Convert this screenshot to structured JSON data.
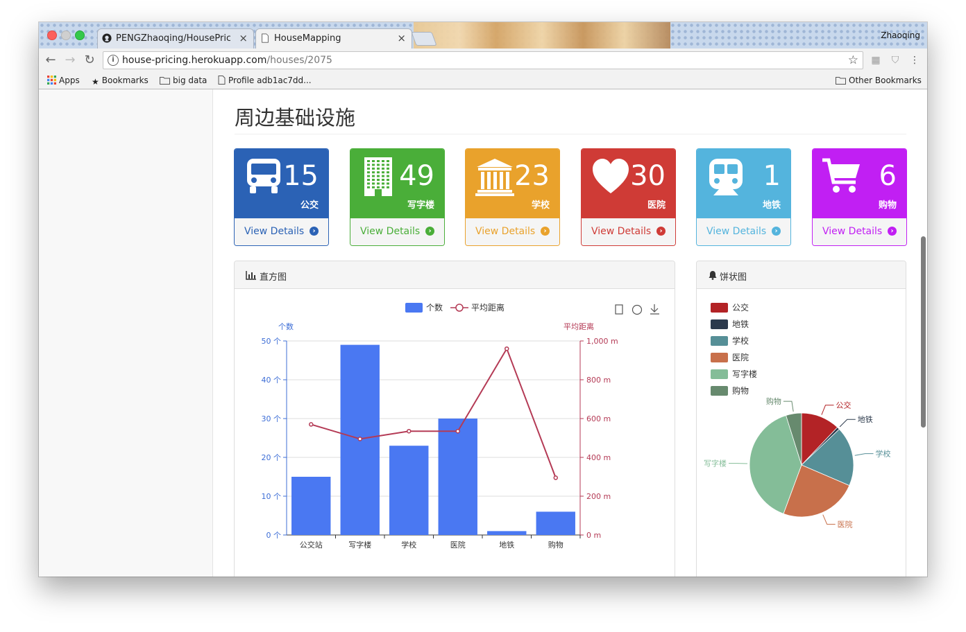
{
  "browser": {
    "tabs": [
      {
        "title": "PENGZhaoqing/HousePricing",
        "icon": "github-icon"
      },
      {
        "title": "HouseMapping",
        "icon": "page-icon"
      }
    ],
    "profile_name": "Zhaoqing",
    "url_host": "house-pricing.herokuapp.com",
    "url_path": "/houses/2075",
    "bookmarks": [
      {
        "label": "Apps",
        "icon": "apps-grid-icon"
      },
      {
        "label": "Bookmarks",
        "icon": "star-icon"
      },
      {
        "label": "big data",
        "icon": "folder-icon"
      },
      {
        "label": "Profile adb1ac7dd...",
        "icon": "page-icon"
      }
    ],
    "other_bookmarks": "Other Bookmarks"
  },
  "page": {
    "title": "周边基础设施",
    "cards": [
      {
        "count": "15",
        "label": "公交",
        "link": "View Details",
        "color": "#2b62b5",
        "icon": "bus-icon"
      },
      {
        "count": "49",
        "label": "写字楼",
        "link": "View Details",
        "color": "#4aae39",
        "icon": "office-building-icon"
      },
      {
        "count": "23",
        "label": "学校",
        "link": "View Details",
        "color": "#e9a22c",
        "icon": "school-icon"
      },
      {
        "count": "30",
        "label": "医院",
        "link": "View Details",
        "color": "#cf3b36",
        "icon": "heart-icon"
      },
      {
        "count": "1",
        "label": "地铁",
        "link": "View Details",
        "color": "#54b4dd",
        "icon": "subway-icon"
      },
      {
        "count": "6",
        "label": "购物",
        "link": "View Details",
        "color": "#c11ff3",
        "icon": "cart-icon"
      }
    ],
    "bar_panel_title": "直方图",
    "pie_panel_title": "饼状图"
  },
  "chart_data": [
    {
      "type": "bar",
      "legend": [
        "个数",
        "平均距离"
      ],
      "categories": [
        "公交站",
        "写字楼",
        "学校",
        "医院",
        "地铁",
        "购物"
      ],
      "series": [
        {
          "name": "个数",
          "type": "bar",
          "values": [
            15,
            49,
            23,
            30,
            1,
            6
          ],
          "color": "#4a78f2"
        },
        {
          "name": "平均距离",
          "type": "line",
          "values": [
            570,
            495,
            535,
            535,
            960,
            295
          ],
          "color": "#b43a55"
        }
      ],
      "ylabel_left": "个数",
      "ylabel_right": "平均距离",
      "ylim_left": [
        0,
        50
      ],
      "ylim_right": [
        0,
        1000
      ],
      "yticks_left": [
        "0 个",
        "10 个",
        "20 个",
        "30 个",
        "40 个",
        "50 个"
      ],
      "yticks_right": [
        "0 m",
        "200 m",
        "400 m",
        "600 m",
        "800 m",
        "1,000 m"
      ],
      "grid": true,
      "legend_position": "top-center"
    },
    {
      "type": "pie",
      "legend": [
        "公交",
        "地铁",
        "学校",
        "医院",
        "写字楼",
        "购物"
      ],
      "slice_labels": [
        "公交",
        "地铁",
        "学校",
        "医院",
        "写字楼",
        "购物"
      ],
      "values": [
        15,
        1,
        23,
        30,
        49,
        6
      ],
      "colors": [
        "#b32326",
        "#2c3a4c",
        "#568f97",
        "#c8704b",
        "#84bd98",
        "#678a6e"
      ],
      "legend_position": "top-left"
    }
  ]
}
